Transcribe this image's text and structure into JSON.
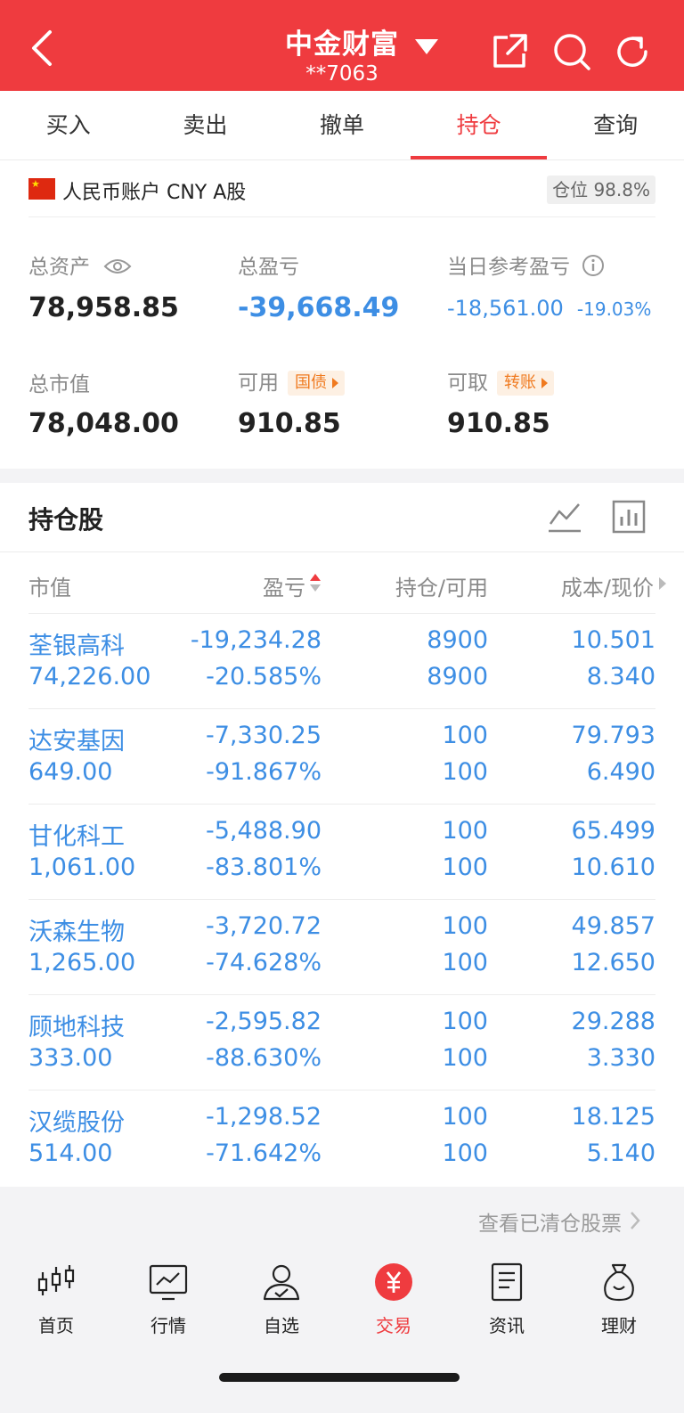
{
  "header": {
    "title": "中金财富",
    "account_no": "**7063"
  },
  "tabs": [
    {
      "label": "买入"
    },
    {
      "label": "卖出"
    },
    {
      "label": "撤单"
    },
    {
      "label": "持仓",
      "active": true
    },
    {
      "label": "查询"
    }
  ],
  "account": {
    "label": "人民币账户 CNY A股",
    "position_ratio": "仓位 98.8%"
  },
  "stats": {
    "total_assets_label": "总资产",
    "total_assets": "78,958.85",
    "total_pl_label": "总盈亏",
    "total_pl": "-39,668.49",
    "daily_pl_label": "当日参考盈亏",
    "daily_pl": "-18,561.00",
    "daily_pl_pct": "-19.03%",
    "market_value_label": "总市值",
    "market_value": "78,048.00",
    "available_label": "可用",
    "available_tag": "国债",
    "available": "910.85",
    "withdrawable_label": "可取",
    "withdrawable_tag": "转账",
    "withdrawable": "910.85"
  },
  "holdings": {
    "title": "持仓股",
    "columns": [
      "市值",
      "盈亏",
      "持仓/可用",
      "成本/现价"
    ],
    "rows": [
      {
        "name": "荃银高科",
        "market_value": "74,226.00",
        "pl": "-19,234.28",
        "pl_pct": "-20.585%",
        "position": "8900",
        "available": "8900",
        "cost": "10.501",
        "price": "8.340"
      },
      {
        "name": "达安基因",
        "market_value": "649.00",
        "pl": "-7,330.25",
        "pl_pct": "-91.867%",
        "position": "100",
        "available": "100",
        "cost": "79.793",
        "price": "6.490"
      },
      {
        "name": "甘化科工",
        "market_value": "1,061.00",
        "pl": "-5,488.90",
        "pl_pct": "-83.801%",
        "position": "100",
        "available": "100",
        "cost": "65.499",
        "price": "10.610"
      },
      {
        "name": "沃森生物",
        "market_value": "1,265.00",
        "pl": "-3,720.72",
        "pl_pct": "-74.628%",
        "position": "100",
        "available": "100",
        "cost": "49.857",
        "price": "12.650"
      },
      {
        "name": "顾地科技",
        "market_value": "333.00",
        "pl": "-2,595.82",
        "pl_pct": "-88.630%",
        "position": "100",
        "available": "100",
        "cost": "29.288",
        "price": "3.330"
      },
      {
        "name": "汉缆股份",
        "market_value": "514.00",
        "pl": "-1,298.52",
        "pl_pct": "-71.642%",
        "position": "100",
        "available": "100",
        "cost": "18.125",
        "price": "5.140"
      }
    ],
    "view_cleared": "查看已清仓股票"
  },
  "bottom_nav": [
    {
      "label": "首页",
      "icon": "candlestick-icon"
    },
    {
      "label": "行情",
      "icon": "market-chart-icon"
    },
    {
      "label": "自选",
      "icon": "user-check-icon"
    },
    {
      "label": "交易",
      "icon": "yuan-circle-icon",
      "active": true
    },
    {
      "label": "资讯",
      "icon": "news-document-icon"
    },
    {
      "label": "理财",
      "icon": "money-bag-icon"
    }
  ],
  "colors": {
    "brand_red": "#ef3b3f",
    "loss_blue": "#3d8ee4",
    "tag_orange": "#f07a1f"
  }
}
